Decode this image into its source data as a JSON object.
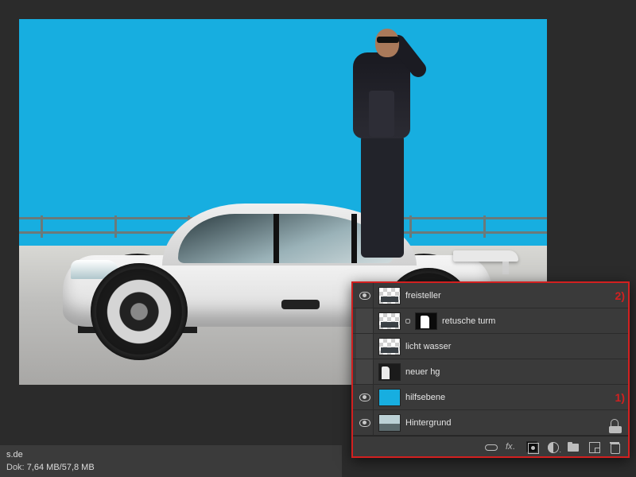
{
  "canvas": {
    "background_color": "#17aee0"
  },
  "status": {
    "url_fragment": "s.de",
    "doc_label": "Dok:",
    "doc_size": "7,64 MB/57,8 MB"
  },
  "layers_panel": {
    "annotations": {
      "a1": "1)",
      "a2": "2)"
    },
    "layers": [
      {
        "visible": true,
        "thumb": "checker",
        "mask": false,
        "name": "freisteller",
        "annot": "a2",
        "locked": false
      },
      {
        "visible": false,
        "thumb": "checker",
        "mask": true,
        "name": "retusche turm",
        "annot": null,
        "locked": false
      },
      {
        "visible": false,
        "thumb": "checker",
        "mask": false,
        "name": "licht wasser",
        "annot": null,
        "locked": false
      },
      {
        "visible": false,
        "thumb": "dark",
        "mask": false,
        "name": "neuer hg",
        "annot": null,
        "locked": false
      },
      {
        "visible": true,
        "thumb": "cyan",
        "mask": false,
        "name": "hilfsebene",
        "annot": "a1",
        "locked": false
      },
      {
        "visible": true,
        "thumb": "photo",
        "mask": false,
        "name": "Hintergrund",
        "annot": null,
        "locked": true
      }
    ],
    "footer_icons": [
      "link",
      "fx",
      "mask",
      "adjust",
      "group",
      "new",
      "delete"
    ]
  }
}
